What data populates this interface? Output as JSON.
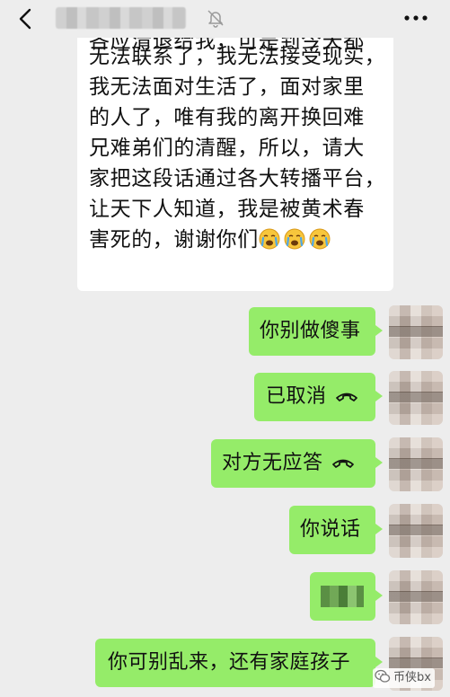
{
  "chat": {
    "incoming_partial_line": "各应清退给我，可是到今天都",
    "incoming_lines": [
      "无法联系了，我无法接受现实，",
      "我无法面对生活了，面对家里",
      "的人了，唯有我的离开换回难",
      "兄难弟们的清醒，所以，请大",
      "家把这段话通过各大转播平台，",
      "让天下人知道，我是被黄术春"
    ],
    "incoming_last_line": "害死的，谢谢你们",
    "incoming_emojis": [
      "crying-face-icon",
      "crying-face-icon",
      "crying-face-icon"
    ],
    "messages": [
      {
        "text": "你别做傻事",
        "icon": ""
      },
      {
        "text": "已取消",
        "icon": "phone-hangup-icon"
      },
      {
        "text": "对方无应答",
        "icon": "phone-hangup-icon"
      },
      {
        "text": "你说话",
        "icon": ""
      },
      {
        "text": "",
        "icon": "blurred-content"
      },
      {
        "text": "你可别乱来，还有家庭孩子",
        "icon": ""
      }
    ]
  },
  "watermark": {
    "text": "币侠bx"
  },
  "colors": {
    "background": "#ededed",
    "incoming_bubble": "#ffffff",
    "outgoing_bubble": "#95ec69",
    "text": "#111111"
  }
}
